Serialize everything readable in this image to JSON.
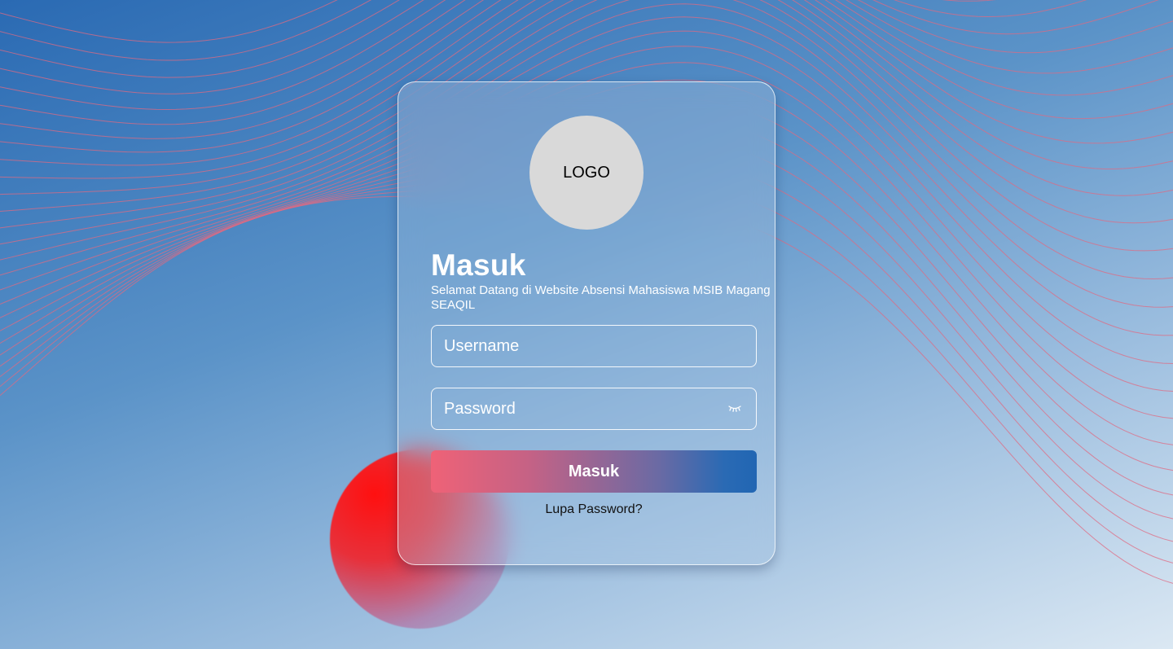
{
  "logo": {
    "text": "LOGO"
  },
  "login": {
    "title": "Masuk",
    "subtitle": "Selamat Datang di Website Absensi Mahasiswa MSIB Magang SEAQIL",
    "username_placeholder": "Username",
    "username_value": "",
    "password_placeholder": "Password",
    "password_value": "",
    "password_toggle_icon": "eye-closed-icon",
    "submit_label": "Masuk",
    "forgot_label": "Lupa Password?"
  },
  "theme": {
    "background_start": "#2a6ab3",
    "background_end": "#dbe8f3",
    "wave_color": "#e06a82",
    "accent_red": "#ff1010",
    "button_start": "#ef6277",
    "button_end": "#2166b3",
    "logo_bg": "#d9d9d9"
  }
}
